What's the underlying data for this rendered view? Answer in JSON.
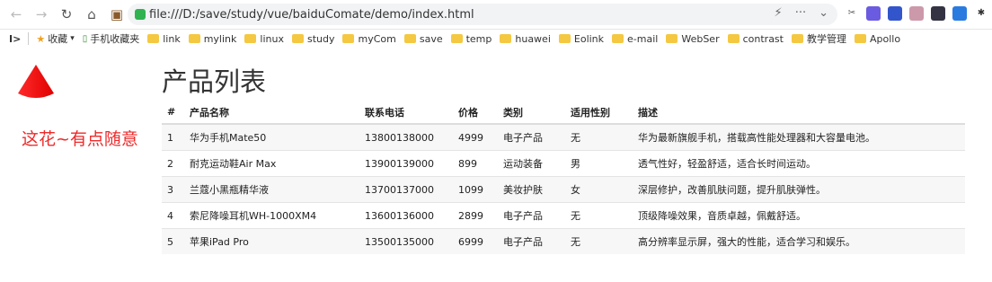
{
  "browser": {
    "url": "file:///D:/save/study/vue/baiduComate/demo/index.html",
    "bookmarks_label": "收藏",
    "bookmarks": [
      "手机收藏夹",
      "link",
      "mylink",
      "linux",
      "study",
      "myCom",
      "save",
      "temp",
      "huawei",
      "Eolink",
      "e-mail",
      "WebSer",
      "contrast",
      "教学管理",
      "Apollo"
    ]
  },
  "page": {
    "slogan": "这花~有点随意",
    "title": "产品列表"
  },
  "table": {
    "headers": [
      "#",
      "产品名称",
      "联系电话",
      "价格",
      "类别",
      "适用性别",
      "描述"
    ],
    "rows": [
      [
        "1",
        "华为手机Mate50",
        "13800138000",
        "4999",
        "电子产品",
        "无",
        "华为最新旗舰手机，搭载高性能处理器和大容量电池。"
      ],
      [
        "2",
        "耐克运动鞋Air Max",
        "13900139000",
        "899",
        "运动装备",
        "男",
        "透气性好，轻盈舒适，适合长时间运动。"
      ],
      [
        "3",
        "兰蔻小黑瓶精华液",
        "13700137000",
        "1099",
        "美妆护肤",
        "女",
        "深层修护，改善肌肤问题，提升肌肤弹性。"
      ],
      [
        "4",
        "索尼降噪耳机WH-1000XM4",
        "13600136000",
        "2899",
        "电子产品",
        "无",
        "顶级降噪效果，音质卓越，佩戴舒适。"
      ],
      [
        "5",
        "苹果iPad Pro",
        "13500135000",
        "6999",
        "电子产品",
        "无",
        "高分辨率显示屏，强大的性能，适合学习和娱乐。"
      ]
    ]
  }
}
